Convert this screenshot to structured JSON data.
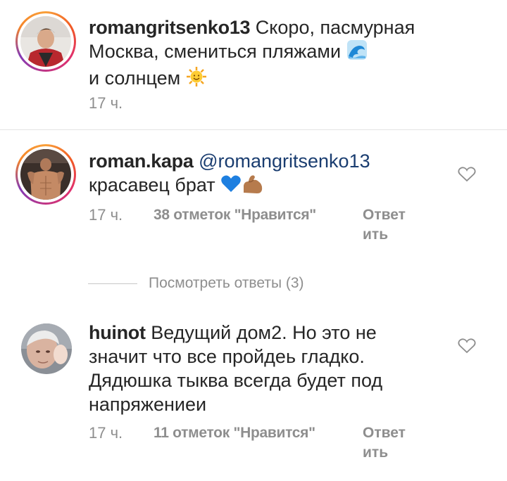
{
  "post": {
    "username": "romangritsenko13",
    "caption_line1": "Скоро, пасмурная",
    "caption_line2": "Москва,  смениться пляжами",
    "caption_line3": "и солнцем",
    "time": "17 ч."
  },
  "comments": [
    {
      "username": "roman.kapa",
      "mention": "@romangritsenko13",
      "text": "красавец брат",
      "time": "17 ч.",
      "likes": "38 отметок \"Нравится\"",
      "reply_line1": "Ответ",
      "reply_line2": "ить"
    },
    {
      "username": "huinot",
      "line1": "Ведущий дом2. Но это не",
      "line2": "значит что все пройдеь гладко.",
      "line3": "Дядюшка тыква всегда будет под",
      "line4": "напряжениеи",
      "time": "17 ч.",
      "likes": "11 отметок \"Нравится\"",
      "reply_line1": "Ответ",
      "reply_line2": "ить"
    }
  ],
  "view_replies": {
    "label": "Посмотреть ответы (3)"
  },
  "icons": {
    "wave": "water-wave-emoji",
    "sun": "sun-with-face-emoji",
    "heart": "blue-heart-emoji",
    "muscle": "flexed-biceps-emoji",
    "like": "heart-outline-icon"
  },
  "colors": {
    "text": "#262626",
    "muted": "#8e8e8e",
    "mention": "#1a3d70",
    "divider": "#e3e3e3"
  }
}
